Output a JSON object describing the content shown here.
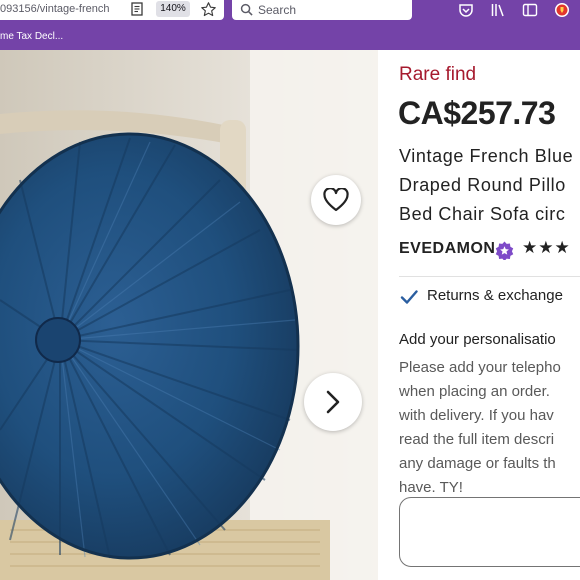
{
  "browser": {
    "url": "093156/vintage-french",
    "zoom": "140%",
    "search_placeholder": "Search",
    "bookmark": "me Tax Decl...",
    "accent_color": "#7443a8",
    "icons": [
      "reader-view-icon",
      "bookmark-star-icon",
      "search-icon",
      "pocket-icon",
      "library-icon",
      "sidebar-icon",
      "extension-icon"
    ]
  },
  "product": {
    "badge": "Rare find",
    "price": "CA$257.73",
    "title_lines": [
      "Vintage French Blue",
      "Draped Round Pillo",
      "Bed Chair Sofa circ"
    ],
    "shop_name": "EVEDAMON",
    "rating_stars": "★★★",
    "returns": "Returns & exchange",
    "personalisation_label": "Add your personalisatio",
    "personalisation_instructions": [
      "Please add your telepho",
      "when placing an order.",
      "with delivery. If you hav",
      "read the full item descri",
      "any damage or faults th",
      "have. TY!"
    ],
    "colors": {
      "badge": "#a61a2e",
      "pillow": "#1f4f7d"
    }
  }
}
